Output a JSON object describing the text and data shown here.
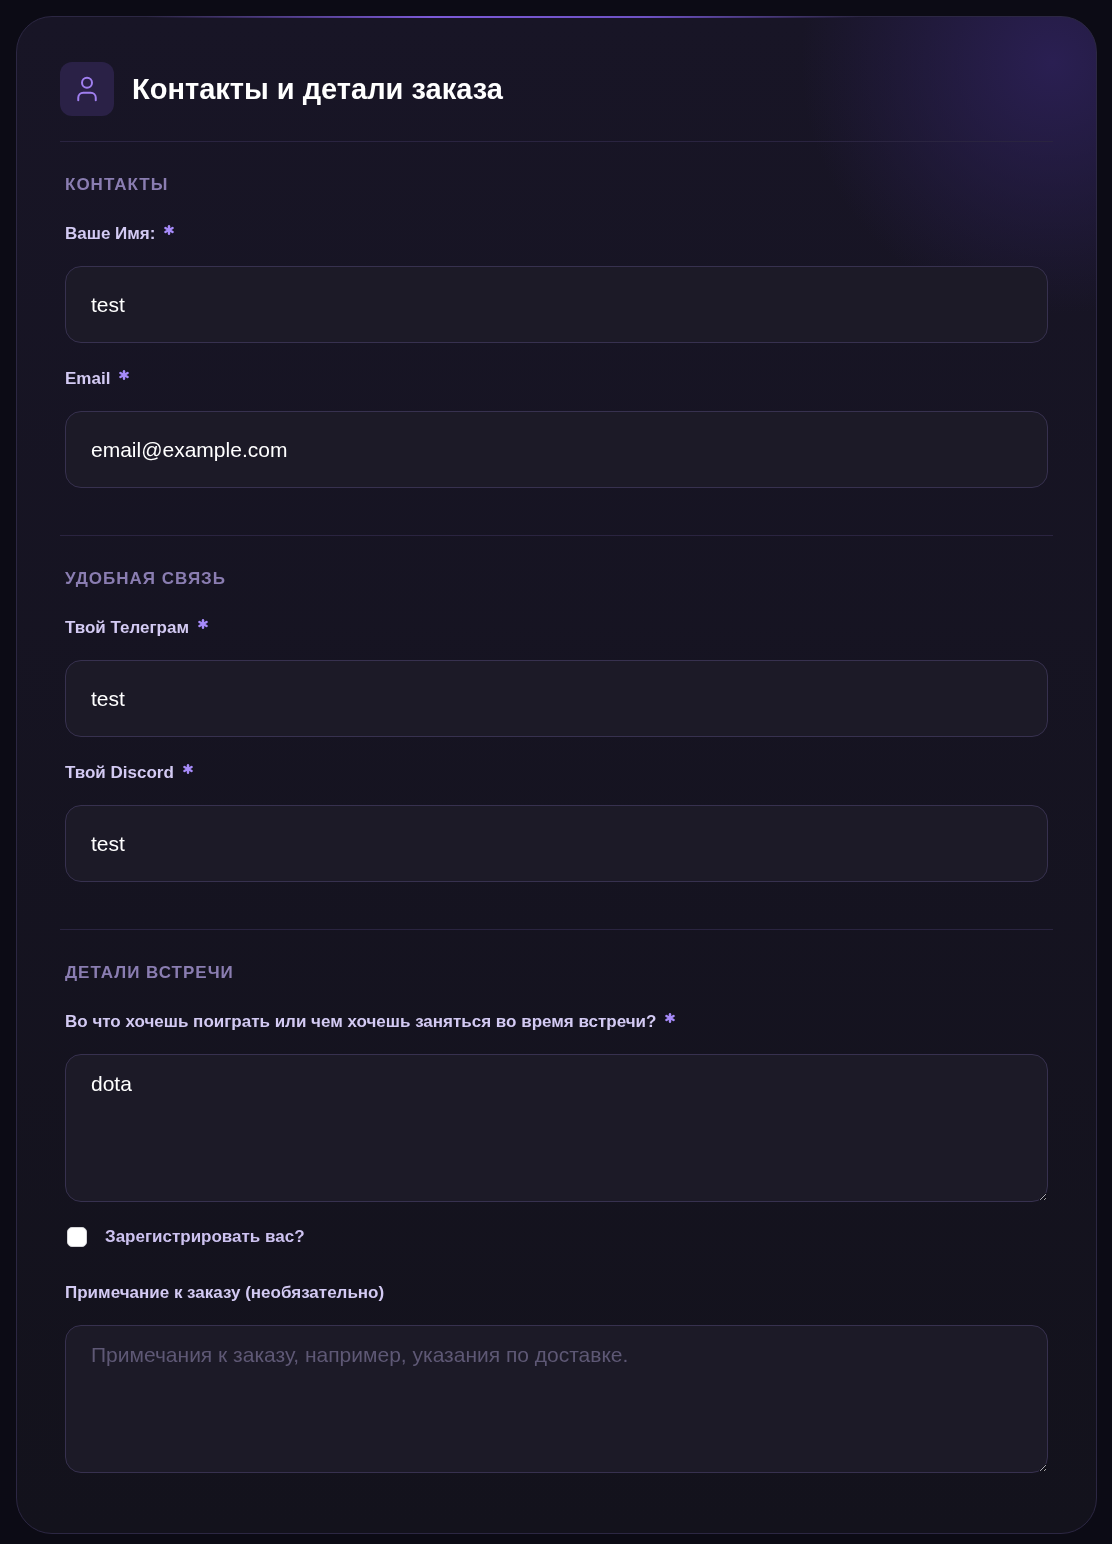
{
  "header": {
    "title": "Контакты и детали заказа"
  },
  "sections": [
    {
      "title": "КОНТАКТЫ",
      "fields": [
        {
          "kind": "input",
          "label": "Ваше Имя:",
          "required": true,
          "value": "test"
        },
        {
          "kind": "input",
          "label": "Email",
          "required": true,
          "value": "email@example.com"
        }
      ]
    },
    {
      "title": "УДОБНАЯ СВЯЗЬ",
      "fields": [
        {
          "kind": "input",
          "label": "Твой Телеграм",
          "required": true,
          "value": "test"
        },
        {
          "kind": "input",
          "label": "Твой Discord",
          "required": true,
          "value": "test"
        }
      ]
    },
    {
      "title": "ДЕТАЛИ ВСТРЕЧИ",
      "fields": [
        {
          "kind": "textarea",
          "label": "Во что хочешь поиграть или чем хочешь заняться во время встречи?",
          "required": true,
          "value": "dota"
        },
        {
          "kind": "checkbox",
          "label": "Зарегистрировать вас?",
          "checked": false
        },
        {
          "kind": "textarea",
          "label": "Примечание к заказу (необязательно)",
          "required": false,
          "placeholder": "Примечания к заказу, например, указания по доставке."
        }
      ]
    }
  ]
}
